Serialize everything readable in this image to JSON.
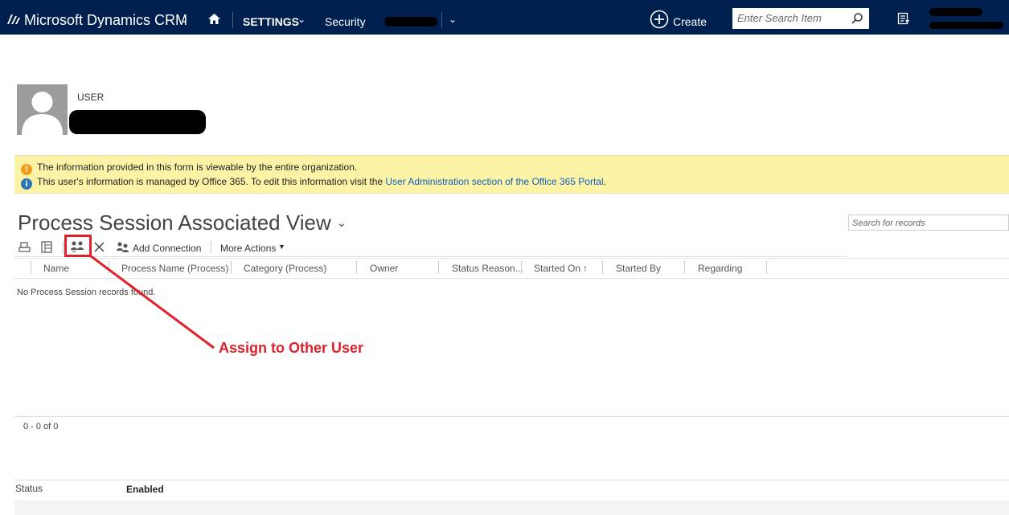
{
  "topnav": {
    "app_title": "Microsoft Dynamics CRM",
    "settings": "SETTINGS",
    "security": "Security",
    "create": "Create",
    "search_placeholder": "Enter Search Item"
  },
  "record": {
    "entity_label": "USER"
  },
  "notifications": {
    "line1": "The information provided in this form is viewable by the entire organization.",
    "line2_text": "This user's information is managed by Office 365. To edit this information visit the ",
    "line2_link": "User Administration section of the Office 365 Portal",
    "line2_end": "."
  },
  "view": {
    "title": "Process Session Associated View",
    "search_placeholder": "Search for records",
    "commands": {
      "add_connection": "Add Connection",
      "more_actions": "More Actions"
    },
    "columns": [
      "Name",
      "Process Name (Process)",
      "Category (Process)",
      "Owner",
      "Status Reason...",
      "Started On",
      "Started By",
      "Regarding"
    ],
    "empty_message": "No Process Session records found.",
    "pager": "0 - 0 of 0"
  },
  "footer": {
    "status_label": "Status",
    "status_value": "Enabled"
  },
  "annotation": {
    "text": "Assign to Other User",
    "color": "#e0202a"
  },
  "colors": {
    "nav_bg": "#002050",
    "notif_bg": "#fcf3a7",
    "link": "#1160b7"
  }
}
